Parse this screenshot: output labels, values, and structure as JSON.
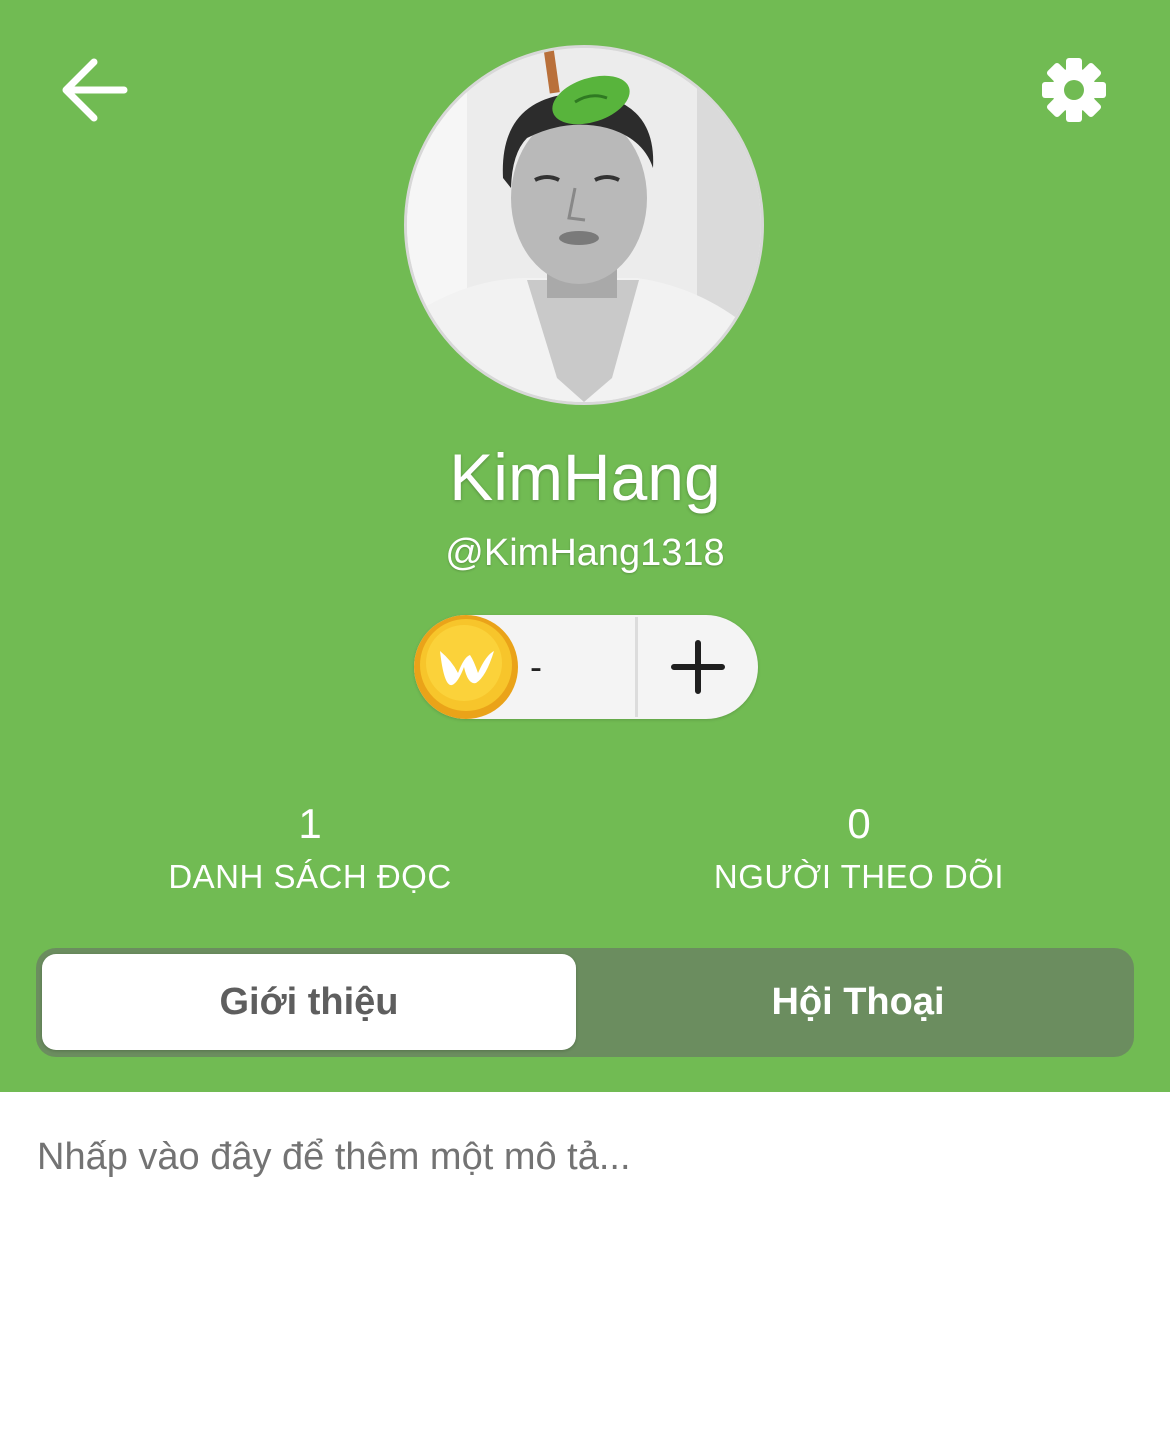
{
  "colors": {
    "header_background": "#71bb53",
    "tab_bar_background": "#6b8d5f",
    "coin_gold": "#f4b71c"
  },
  "header": {
    "back_icon": "arrow-left-icon",
    "settings_icon": "gear-icon"
  },
  "profile": {
    "display_name": "KimHang",
    "username": "@KimHang1318"
  },
  "coins": {
    "icon": "wattpad-coin-icon",
    "balance": "-",
    "add_icon": "plus-icon"
  },
  "stats": [
    {
      "value": "1",
      "label": "DANH SÁCH ĐỌC"
    },
    {
      "value": "0",
      "label": "NGƯỜI THEO DÕI"
    }
  ],
  "tabs": [
    {
      "label": "Giới thiệu",
      "selected": true
    },
    {
      "label": "Hội Thoại",
      "selected": false
    }
  ],
  "about": {
    "description_placeholder": "Nhấp vào đây để thêm một mô tả..."
  }
}
